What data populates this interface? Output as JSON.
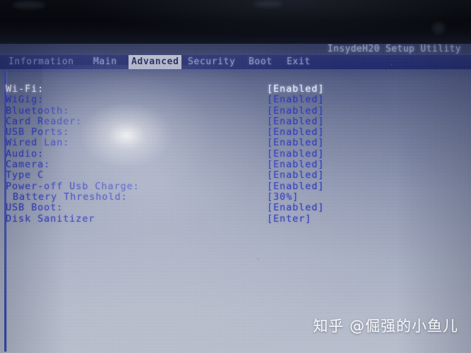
{
  "app": {
    "title": "InsydeH20 Setup Utility"
  },
  "menu": {
    "tabs": [
      {
        "label": "Information",
        "active": false
      },
      {
        "label": "Main",
        "active": false
      },
      {
        "label": "Advanced",
        "active": true
      },
      {
        "label": "Security",
        "active": false
      },
      {
        "label": "Boot",
        "active": false
      },
      {
        "label": "Exit",
        "active": false
      }
    ]
  },
  "settings": {
    "rows": [
      {
        "label": "Wi-Fi:",
        "value": "[Enabled]",
        "selected": true,
        "indented": false
      },
      {
        "label": "WiGig:",
        "value": "[Enabled]",
        "selected": false,
        "indented": false
      },
      {
        "label": "Bluetooth:",
        "value": "[Enabled]",
        "selected": false,
        "indented": false
      },
      {
        "label": "Card Reader:",
        "value": "[Enabled]",
        "selected": false,
        "indented": false
      },
      {
        "label": "USB Ports:",
        "value": "[Enabled]",
        "selected": false,
        "indented": false
      },
      {
        "label": "Wired Lan:",
        "value": "[Enabled]",
        "selected": false,
        "indented": false
      },
      {
        "label": "Audio:",
        "value": "[Enabled]",
        "selected": false,
        "indented": false
      },
      {
        "label": "Camera:",
        "value": "[Enabled]",
        "selected": false,
        "indented": false
      },
      {
        "label": "Type C",
        "value": "[Enabled]",
        "selected": false,
        "indented": false
      },
      {
        "label": "Power-off Usb Charge:",
        "value": "[Enabled]",
        "selected": false,
        "indented": false
      },
      {
        "label": "Battery Threshold:",
        "value": "[30%]",
        "selected": false,
        "indented": true
      },
      {
        "label": "USB Boot:",
        "value": "[Enabled]",
        "selected": false,
        "indented": false
      },
      {
        "label": "Disk Sanitizer",
        "value": "[Enter]",
        "selected": false,
        "indented": false
      }
    ]
  },
  "watermark": {
    "text": "知乎 @倔强的小鱼儿"
  },
  "colors": {
    "menubar_blue": "#232c76",
    "text_blue": "#1c27b4",
    "active_tab_bg": "#c9cfe2",
    "panel_light": "#b6bdcd"
  }
}
